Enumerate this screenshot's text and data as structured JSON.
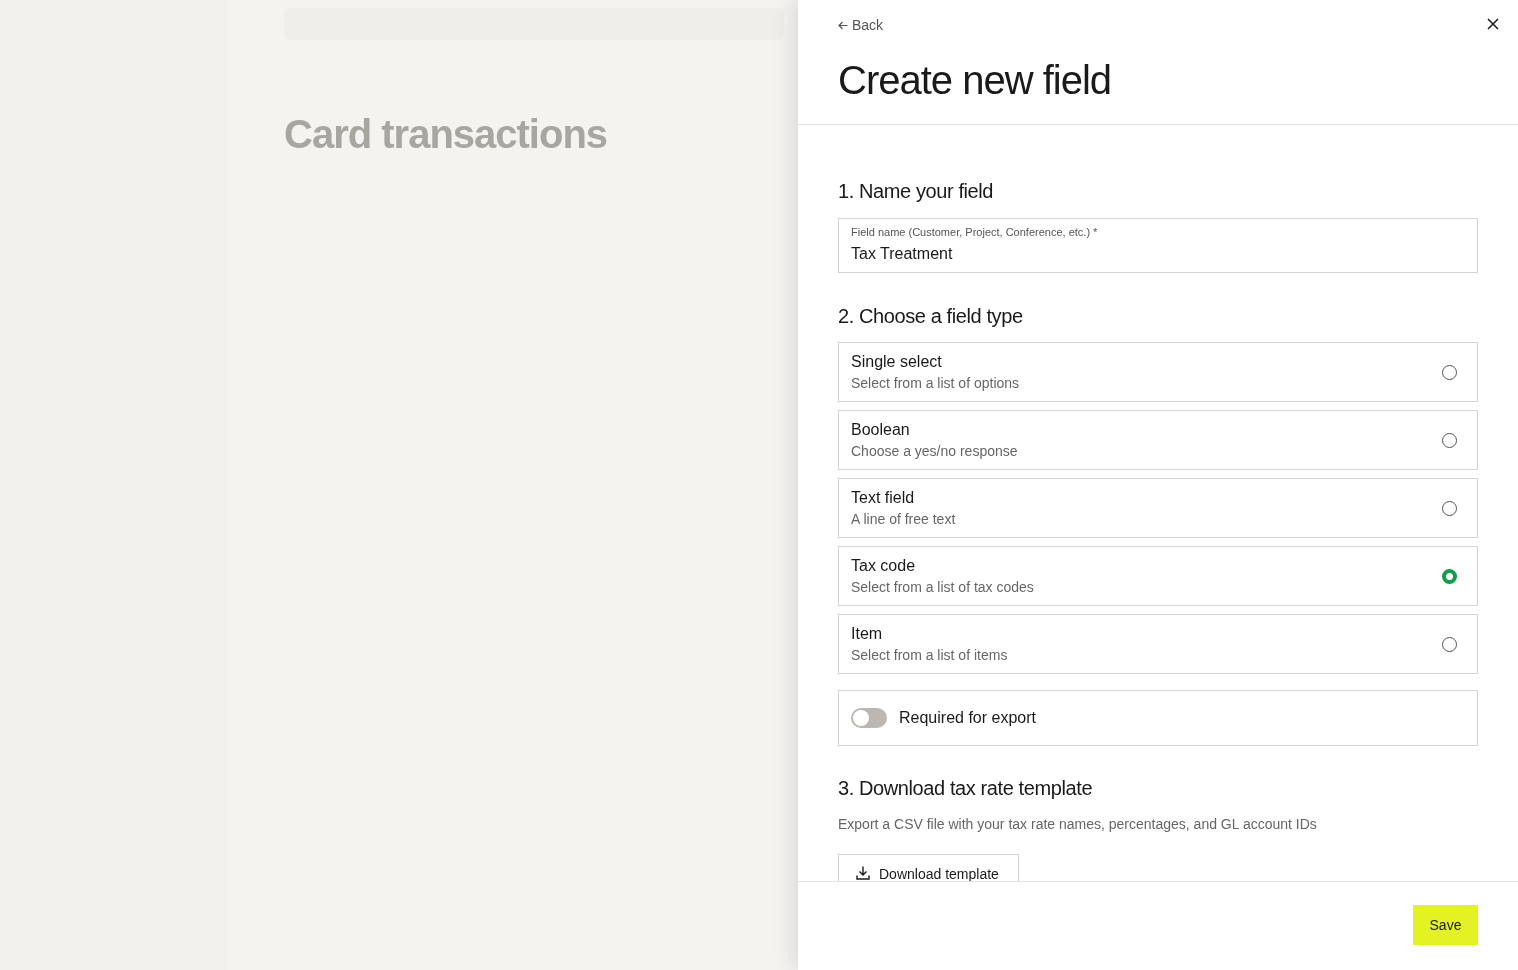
{
  "backdrop": {
    "page_title": "Card transactions"
  },
  "drawer": {
    "back_link": "Back",
    "title": "Create new field",
    "name_section": {
      "heading": "1. Name your field",
      "field": {
        "label": "Field name (Customer, Project, Conference, etc.) *",
        "value": "Tax Treatment"
      }
    },
    "type_section": {
      "heading": "2. Choose a field type",
      "options": [
        {
          "title": "Single select",
          "description": "Select from a list of options",
          "selected": false
        },
        {
          "title": "Boolean",
          "description": "Choose a yes/no response",
          "selected": false
        },
        {
          "title": "Text field",
          "description": "A line of free text",
          "selected": false
        },
        {
          "title": "Tax code",
          "description": "Select from a list of tax codes",
          "selected": true
        },
        {
          "title": "Item",
          "description": "Select from a list of items",
          "selected": false
        }
      ],
      "required_toggle": {
        "label": "Required for export",
        "on": false
      }
    },
    "template_section": {
      "heading": "3. Download tax rate template",
      "description": "Export a CSV file with your tax rate names, percentages, and GL account IDs",
      "button": "Download template"
    },
    "footer": {
      "save_button": "Save"
    }
  }
}
